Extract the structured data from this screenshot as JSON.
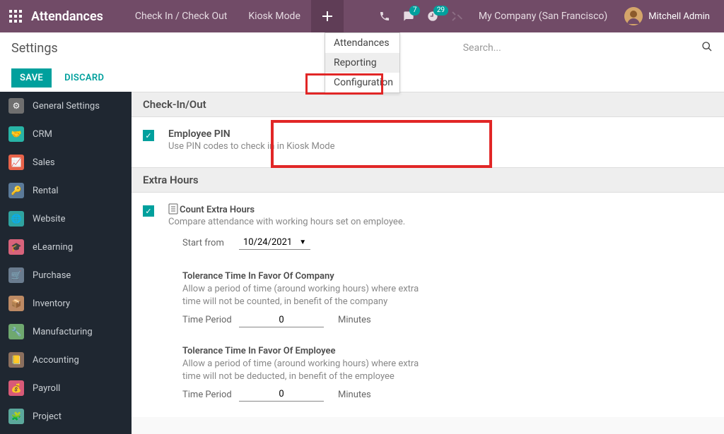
{
  "nav": {
    "app_name": "Attendances",
    "links": [
      "Check In / Check Out",
      "Kiosk Mode"
    ],
    "chat_badge": "7",
    "activity_badge": "29",
    "company": "My Company (San Francisco)",
    "user": "Mitchell Admin",
    "dropdown": [
      "Attendances",
      "Reporting",
      "Configuration"
    ]
  },
  "control": {
    "page_title": "Settings",
    "search_placeholder": "Search..."
  },
  "buttons": {
    "save": "SAVE",
    "discard": "DISCARD"
  },
  "sidebar": [
    {
      "label": "General Settings",
      "color": "#6f6f6f"
    },
    {
      "label": "CRM",
      "color": "#28b4a6"
    },
    {
      "label": "Sales",
      "color": "#e8634a"
    },
    {
      "label": "Rental",
      "color": "#5b7a99"
    },
    {
      "label": "Website",
      "color": "#2fa3a0"
    },
    {
      "label": "eLearning",
      "color": "#d8637b"
    },
    {
      "label": "Purchase",
      "color": "#6a7c8f"
    },
    {
      "label": "Inventory",
      "color": "#bd8a64"
    },
    {
      "label": "Manufacturing",
      "color": "#6fa86f"
    },
    {
      "label": "Accounting",
      "color": "#8b6f5e"
    },
    {
      "label": "Payroll",
      "color": "#d85a77"
    },
    {
      "label": "Project",
      "color": "#5ba89c"
    }
  ],
  "sections": {
    "checkinout": {
      "title": "Check-In/Out",
      "pin_label": "Employee PIN",
      "pin_desc": "Use PIN codes to check in in Kiosk Mode"
    },
    "extra": {
      "title": "Extra Hours",
      "count_label": "Count Extra Hours",
      "count_desc": "Compare attendance with working hours set on employee.",
      "start_label": "Start from",
      "start_value": "10/24/2021",
      "tol_company_title": "Tolerance Time In Favor Of Company",
      "tol_company_desc": "Allow a period of time (around working hours) where extra time will not be counted, in benefit of the company",
      "tol_employee_title": "Tolerance Time In Favor Of Employee",
      "tol_employee_desc": "Allow a period of time (around working hours) where extra time will not be deducted, in benefit of the employee",
      "period_label": "Time Period",
      "period_value": "0",
      "period_unit": "Minutes"
    }
  }
}
